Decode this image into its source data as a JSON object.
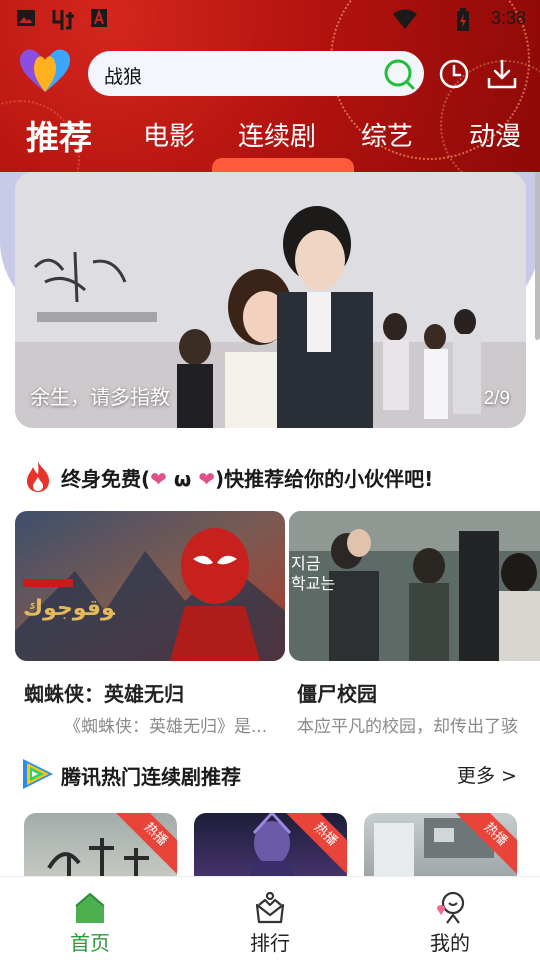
{
  "status_bar": {
    "time": "3:38",
    "icons": [
      "image-icon",
      "bug-icon",
      "text-a-icon",
      "wifi-icon",
      "battery-icon"
    ]
  },
  "search": {
    "value": "战狼"
  },
  "header_buttons": [
    "history-icon",
    "download-icon"
  ],
  "tabs": [
    {
      "label": "推荐",
      "active": true
    },
    {
      "label": "电影",
      "active": false
    },
    {
      "label": "连续剧",
      "active": false
    },
    {
      "label": "综艺",
      "active": false
    },
    {
      "label": "动漫",
      "active": false
    }
  ],
  "banner": {
    "caption": "余生，请多指教",
    "page": "2/9"
  },
  "free_section": {
    "title_prefix": "终身免费(",
    "heart1": "❤",
    "omega": " ω ",
    "heart2": "❤",
    "title_suffix": ")快推荐给你的小伙伴吧!",
    "cards": [
      {
        "title": "蜘蛛侠：英雄无归",
        "desc": "《蜘蛛侠：英雄无归》是..."
      },
      {
        "title": "僵尸校园",
        "desc": "本应平凡的校园，却传出了骇"
      }
    ]
  },
  "tencent_section": {
    "title": "腾讯热门连续剧推荐",
    "more": "更多 >",
    "thumbs": [
      {
        "badge": "热播"
      },
      {
        "badge": "热播"
      },
      {
        "badge": "热播"
      }
    ]
  },
  "bottom_nav": [
    {
      "label": "首页",
      "icon": "home-icon",
      "active": true
    },
    {
      "label": "排行",
      "icon": "ranking-icon",
      "active": false
    },
    {
      "label": "我的",
      "icon": "profile-icon",
      "active": false
    }
  ],
  "colors": {
    "header_red": "#b3130f",
    "accent_green": "#2e9a3a",
    "badge_red": "#e8443a",
    "heart_pink": "#e0508a"
  }
}
